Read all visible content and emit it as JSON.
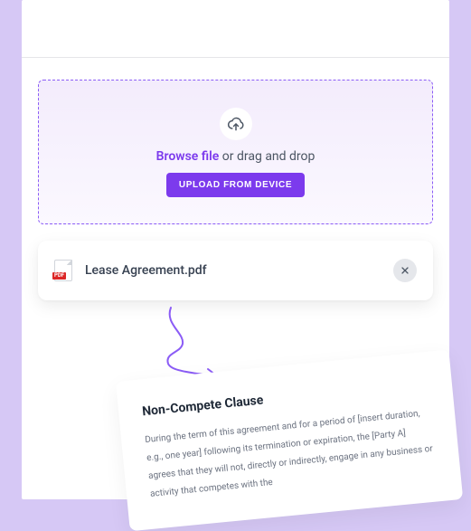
{
  "dropzone": {
    "browse_label": "Browse file",
    "dropzone_suffix": " or drag and drop",
    "upload_button": "UPLOAD FROM DEVICE"
  },
  "file": {
    "icon_badge": "PDF",
    "name": "Lease Agreement.pdf"
  },
  "clause": {
    "title": "Non-Compete Clause",
    "body": "During the term of this agreement and for a period of [insert duration, e.g., one year] following its termination or expiration, the [Party A] agrees that they will not, directly or indirectly, engage in any business or activity that competes with the"
  }
}
